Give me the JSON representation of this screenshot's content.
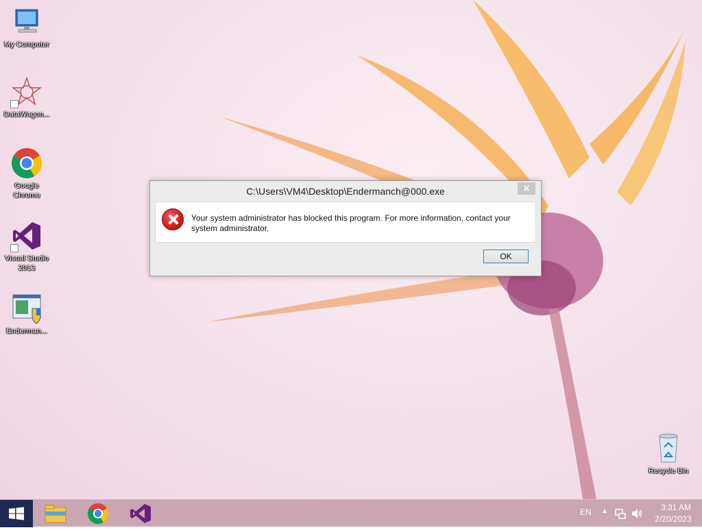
{
  "desktop": {
    "icons": [
      {
        "label": "My Computer",
        "icon": "computer-icon"
      },
      {
        "label": "DataWagon...",
        "icon": "datawagon-icon"
      },
      {
        "label": "Google Chrome",
        "icon": "chrome-icon"
      },
      {
        "label": "Visual Studio 2013",
        "icon": "visual-studio-icon"
      },
      {
        "label": "Enderman...",
        "icon": "exe-shield-icon"
      },
      {
        "label": "Recycle Bin",
        "icon": "recycle-bin-icon"
      }
    ]
  },
  "dialog": {
    "title": "C:\\Users\\VM4\\Desktop\\Endermanch@000.exe",
    "close_label": "×",
    "message": "Your system administrator has blocked this program. For more information, contact your system administrator.",
    "ok_label": "OK",
    "icon": "error-icon"
  },
  "taskbar": {
    "pinned": [
      "file-explorer-icon",
      "chrome-icon",
      "visual-studio-icon"
    ],
    "language": "EN",
    "time": "3:31 AM",
    "date": "2/20/2023"
  },
  "colors": {
    "taskbar": "#c9a6b2",
    "start": "#1e2a52",
    "error_red": "#d21e1e",
    "ok_border": "#3c7fb1"
  }
}
